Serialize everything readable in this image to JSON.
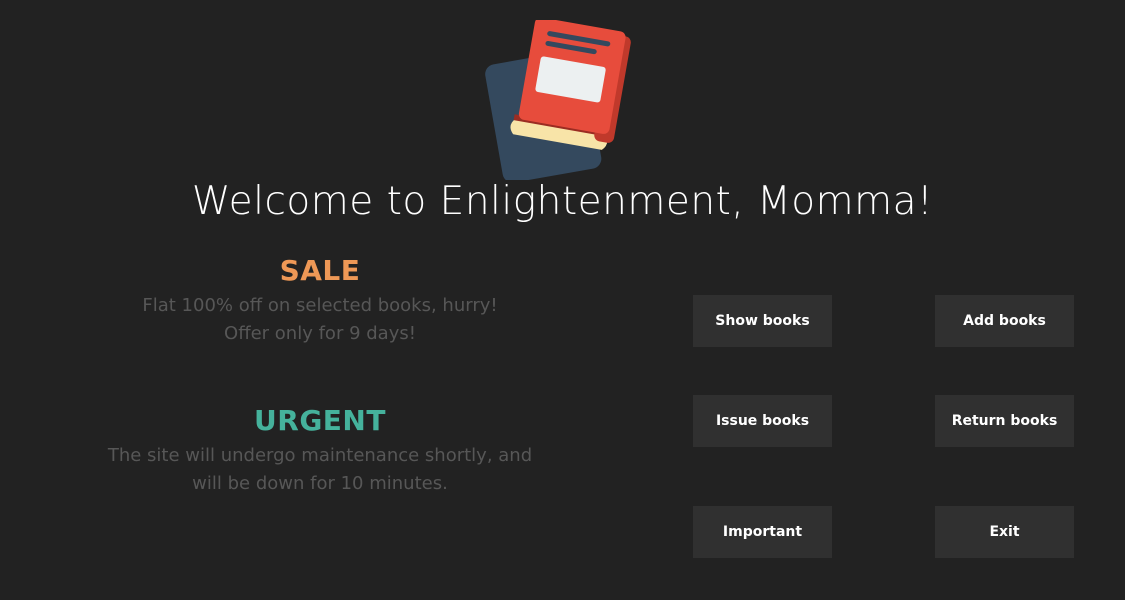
{
  "header": {
    "logo_icon": "books-icon",
    "welcome_text": "Welcome to Enlightenment, Momma!"
  },
  "notices": {
    "sale": {
      "title": "SALE",
      "line1": "Flat 100% off on selected books, hurry!",
      "line2": "Offer only for 9 days!",
      "color": "#ee9856"
    },
    "urgent": {
      "title": "URGENT",
      "line1": "The site will undergo maintenance shortly, and",
      "line2": "will be down for 10 minutes.",
      "color": "#45b29c"
    }
  },
  "buttons": {
    "show_books": "Show books",
    "add_books": "Add books",
    "issue_books": "Issue books",
    "return_books": "Return books",
    "important": "Important",
    "exit": "Exit"
  },
  "colors": {
    "background": "#222222",
    "button_bg": "#303030",
    "body_text": "#575757"
  }
}
